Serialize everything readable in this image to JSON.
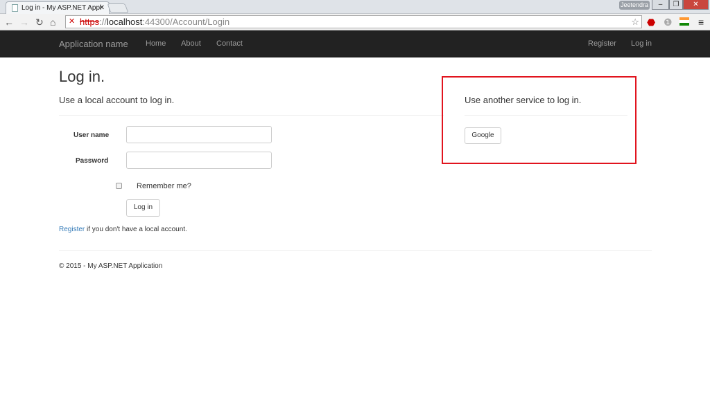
{
  "browser": {
    "tab_title": "Log in - My ASP.NET Appl",
    "url_scheme": "https",
    "url_host": "localhost",
    "url_rest": ":44300/Account/Login",
    "user": "Jeetendra"
  },
  "nav": {
    "brand": "Application name",
    "links": [
      "Home",
      "About",
      "Contact"
    ],
    "right": [
      "Register",
      "Log in"
    ]
  },
  "page": {
    "title": "Log in.",
    "local_heading": "Use a local account to log in.",
    "username_label": "User name",
    "password_label": "Password",
    "remember_label": "Remember me?",
    "login_button": "Log in",
    "register_link": "Register",
    "register_suffix": " if you don't have a local account.",
    "external_heading": "Use another service to log in.",
    "google_button": "Google",
    "footer": "© 2015 - My ASP.NET Application"
  },
  "colors": {
    "highlight": "#e1141e",
    "navbar": "#222222",
    "link": "#337ab7"
  }
}
